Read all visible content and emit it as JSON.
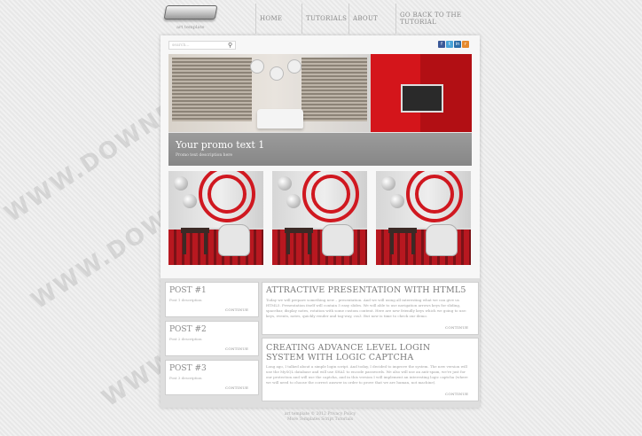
{
  "header": {
    "logo_text": "art template",
    "nav": [
      {
        "label": "HOME"
      },
      {
        "label": "TUTORIALS"
      },
      {
        "label": "ABOUT"
      },
      {
        "label": "GO BACK TO THE TUTORIAL"
      }
    ]
  },
  "search": {
    "placeholder": "search..."
  },
  "social": [
    {
      "icon": "facebook-icon",
      "glyph": "f",
      "color": "#3b5998"
    },
    {
      "icon": "twitter-icon",
      "glyph": "t",
      "color": "#4aa4d9"
    },
    {
      "icon": "linkedin-icon",
      "glyph": "in",
      "color": "#2b6da8"
    },
    {
      "icon": "rss-icon",
      "glyph": "r",
      "color": "#e58a2e"
    }
  ],
  "hero": {
    "title": "Your promo text 1",
    "subtitle": "Promo text description here"
  },
  "posts": [
    {
      "title": "POST #1",
      "desc": "Post 1 description",
      "link": "CONTINUE"
    },
    {
      "title": "POST #2",
      "desc": "Post 2 description",
      "link": "CONTINUE"
    },
    {
      "title": "POST #3",
      "desc": "Post 3 description",
      "link": "CONTINUE"
    }
  ],
  "articles": [
    {
      "title": "ATTRACTIVE PRESENTATION WITH HTML5",
      "body": "Today we will prepare something new – presentation. And we will using all interesting what we can give us HTML5. Presentation itself will contain 5 easy slides. We will able to use navigation arrows keys for sliding, spacebar, display notes, rotation with some custom content. Here are new friendly keys which we going to use: keys, events, notes, quickly render and tag-way, css3. But now is time to check our demo.",
      "link": "CONTINUE"
    },
    {
      "title": "CREATING ADVANCE LEVEL LOGIN SYSTEM WITH LOGIC CAPTCHA",
      "body": "Long ago, I talked about a simple login script. And today, I decided to improve the system. The new version will use the MySQL database and will use SHA1 to encode passwords. We also will use an anti-spam, we're just for our protection and will use the captcha, and in this version I will implement an interesting logic captcha (where we will need to choose the correct answer in order to prove that we are human, not machine).",
      "link": "CONTINUE"
    }
  ],
  "footer": {
    "line1": "art template © 2012 Privacy Policy",
    "line2": "More Templates Script Tutorials"
  },
  "watermark": {
    "text": "WWW.DOWNDEW.COM"
  }
}
